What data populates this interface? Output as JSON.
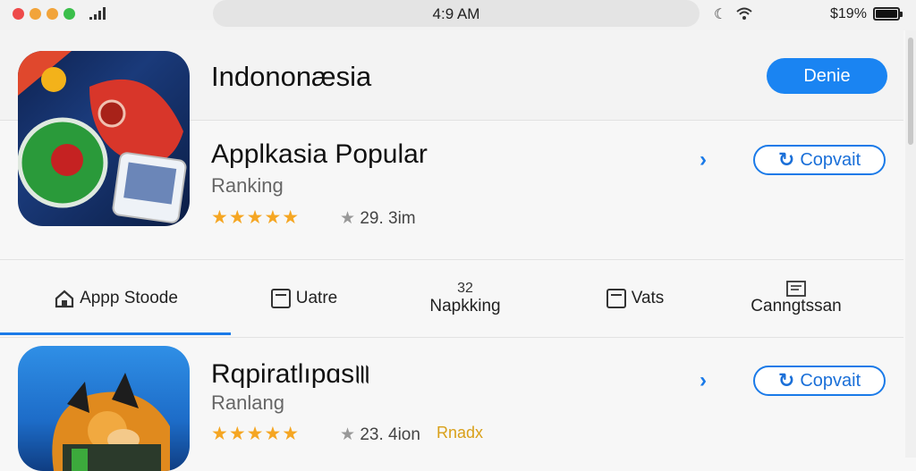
{
  "status_bar": {
    "time": "4:9 AM",
    "battery_text": "$19%",
    "icons": [
      "moon-icon",
      "wifi-icon"
    ],
    "window_dot_colors": [
      "#ee4a4a",
      "#f2a43a",
      "#f2a43a",
      "#3bbf4b"
    ]
  },
  "header": {
    "region_title": "Indononæsia",
    "primary_button": "Denie"
  },
  "apps": [
    {
      "name": "Applkasia Popular",
      "subtitle": "Ranking",
      "stars": "★★★★★",
      "rating_star": "★",
      "rating_count": "29. 3im",
      "button": "Copvait"
    },
    {
      "name": "Rqpiratlıpɑs꠲",
      "subtitle": "Ranlang",
      "stars": "★★★★★",
      "rating_star": "★",
      "rating_count": "23. 4ion",
      "tag": "Rnadx",
      "button": "Copvait"
    }
  ],
  "tabs": [
    {
      "label": "Appp Stoode",
      "icon": "home-icon"
    },
    {
      "label": "Uatre",
      "icon": "box-icon"
    },
    {
      "label": "Napkking",
      "icon": "number-icon",
      "badge": "32"
    },
    {
      "label": "Vats",
      "icon": "box-icon"
    },
    {
      "label": "Canngtssan",
      "icon": "list-icon"
    }
  ],
  "colors": {
    "accent": "#1a7ae8",
    "primary_button": "#1a84f2",
    "star": "#f5a623"
  }
}
